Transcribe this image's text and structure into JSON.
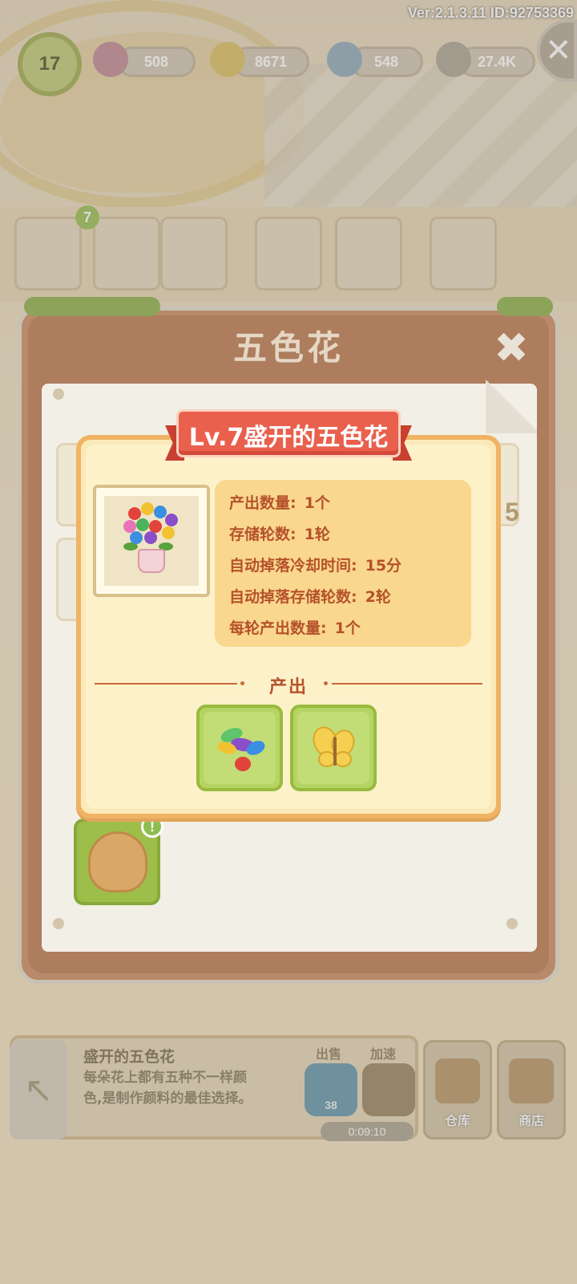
{
  "version_text": "Ver:2.1.3.11 ID:92753369",
  "resources": {
    "level": "17",
    "gems": "508",
    "coins": "8671",
    "energy": "548",
    "seeds": "27.4K"
  },
  "shelf": {
    "badge_count": "7"
  },
  "window": {
    "title": "五色花",
    "slot_count_label": "5"
  },
  "popup": {
    "ribbon_title": "Lv.7盛开的五色花",
    "stats": [
      {
        "label": "产出数量:",
        "value": "1个"
      },
      {
        "label": "存储轮数:",
        "value": "1轮"
      },
      {
        "label": "自动掉落冷却时间:",
        "value": "15分"
      },
      {
        "label": "自动掉落存储轮数:",
        "value": "2轮"
      },
      {
        "label": "每轮产出数量:",
        "value": "1个"
      }
    ],
    "output_label": "产出",
    "outputs": [
      "petals-icon",
      "butterfly-icon"
    ]
  },
  "bottom": {
    "item_title": "盛开的五色花",
    "desc_line1": "每朵花上都有五种不一样颜",
    "desc_line2": "色,是制作颜料的最佳选择。",
    "sell_label": "出售",
    "speed_label": "加速",
    "sell_price": "38",
    "timer": "0:09:10",
    "warehouse_label": "仓库",
    "shop_label": "商店"
  },
  "colors": {
    "ribbon": "#e9604d",
    "popup_border": "#f0b364",
    "stat_text": "#b5522a",
    "output_slot": "#b6d463"
  }
}
